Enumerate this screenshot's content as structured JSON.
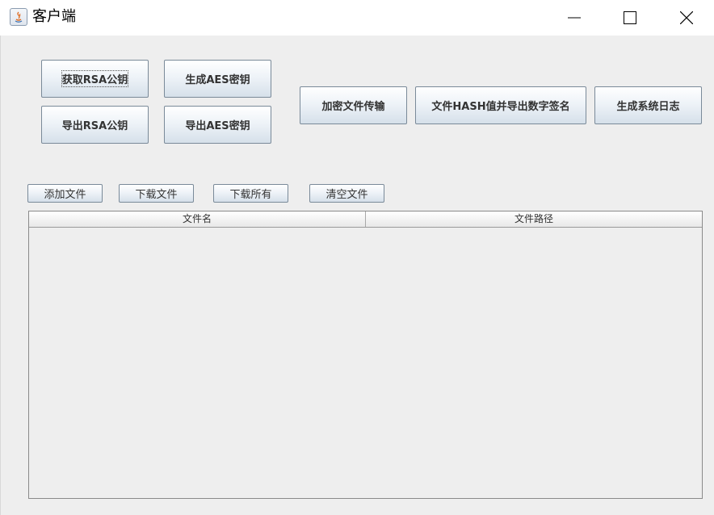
{
  "window": {
    "title": "客户端"
  },
  "top_buttons": {
    "get_rsa": "获取RSA公钥",
    "gen_aes": "生成AES密钥",
    "export_rsa": "导出RSA公钥",
    "export_aes": "导出AES密钥",
    "encrypt_transfer": "加密文件传输",
    "hash_sign": "文件HASH值并导出数字签名",
    "gen_log": "生成系统日志"
  },
  "file_buttons": {
    "add": "添加文件",
    "download": "下载文件",
    "download_all": "下载所有",
    "clear": "清空文件"
  },
  "table": {
    "columns": [
      "文件名",
      "文件路径"
    ],
    "rows": []
  }
}
